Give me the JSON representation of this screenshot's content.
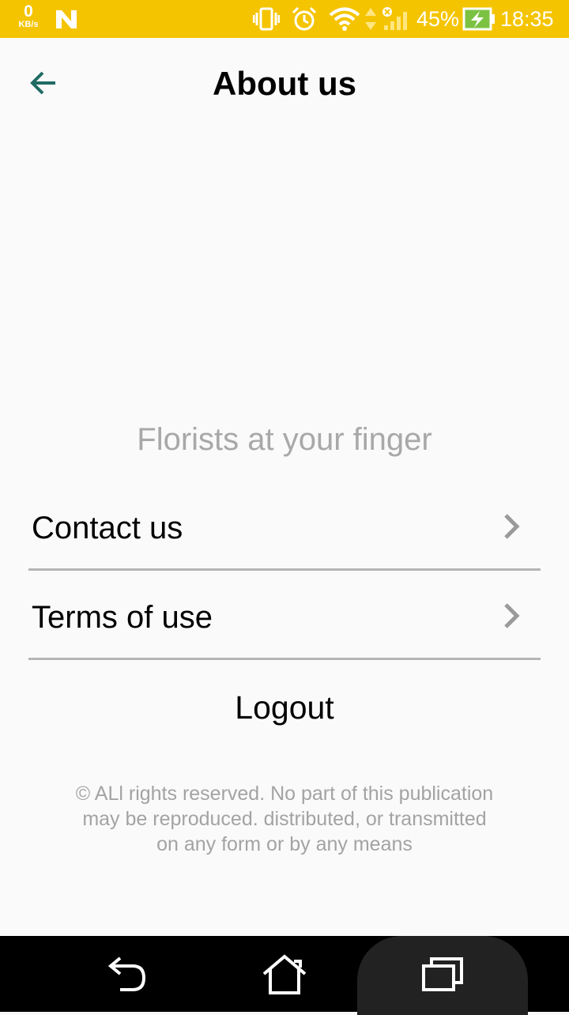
{
  "status_bar": {
    "net_speed_value": "0",
    "net_speed_unit": "KB/s",
    "battery_percent": "45%",
    "time": "18:35",
    "icons": [
      "notification-n-icon",
      "vibrate-icon",
      "alarm-icon",
      "wifi-icon",
      "data-transfer-icon",
      "signal-icon",
      "battery-charging-icon"
    ],
    "colors": {
      "background": "#f5c400",
      "battery_fill": "#7cc242"
    }
  },
  "header": {
    "title": "About us",
    "back_icon": "arrow-left-icon",
    "back_icon_color": "#1f6b63"
  },
  "main": {
    "tagline": "Florists at your finger",
    "menu": [
      {
        "label": "Contact us",
        "icon": "chevron-right-icon"
      },
      {
        "label": "Terms of use",
        "icon": "chevron-right-icon"
      }
    ],
    "logout_label": "Logout",
    "copyright_lines": [
      "© ALl rights reserved. No part of this publication",
      "may be reproduced. distributed, or transmitted",
      "on any form or by any means"
    ]
  },
  "nav_bar": {
    "buttons": [
      "back-nav-icon",
      "home-icon",
      "recents-icon"
    ]
  }
}
